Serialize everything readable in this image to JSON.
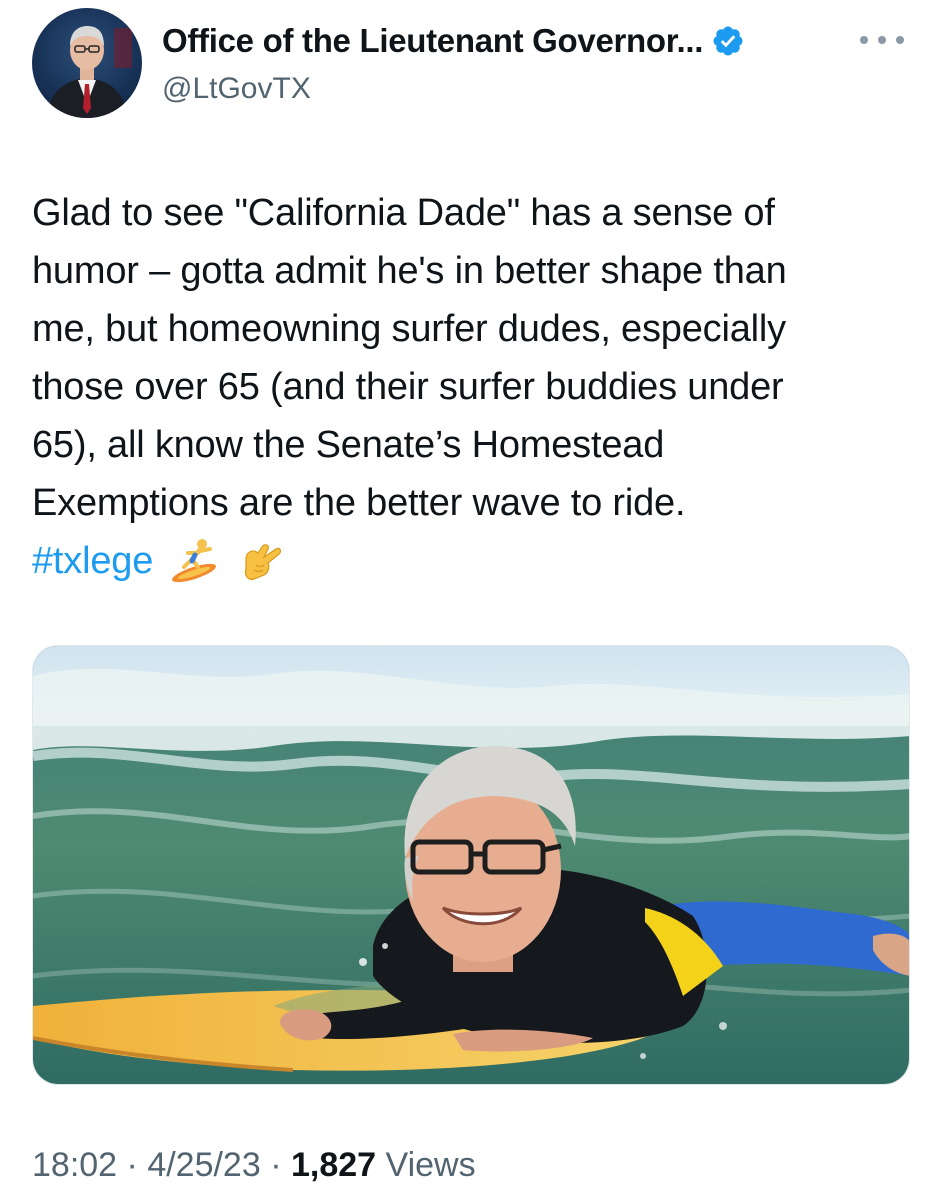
{
  "author": {
    "display_name": "Office of the Lieutenant Governor...",
    "handle": "@LtGovTX",
    "verified": true,
    "verified_color": "#1d9bf0"
  },
  "tweet": {
    "lines": [
      "Glad to see \"California Dade\" has a sense of",
      "humor – gotta admit he's in better shape than",
      "me, but homeowning surfer dudes, especially",
      "those over 65 (and their surfer buddies under",
      "65), all know the Senate’s Homestead",
      "Exemptions are the better wave to ride."
    ],
    "hashtag": "#txlege",
    "emojis": [
      "surfer-emoji",
      "call-me-hand-emoji"
    ],
    "hashtag_color": "#1d9bf0"
  },
  "meta": {
    "time": "18:02",
    "separator": " · ",
    "date": "4/25/23",
    "views_count": "1,827",
    "views_label": " Views"
  },
  "icons": {
    "more": "more-dots-icon",
    "verified": "verified-badge-icon"
  }
}
